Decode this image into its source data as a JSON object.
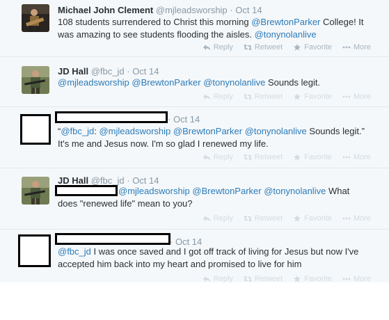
{
  "actions": {
    "reply": "Reply",
    "retweet": "Retweet",
    "favorite": "Favorite",
    "more": "More"
  },
  "tweets": [
    {
      "fullname": "Michael John Clement",
      "username": "@mjleadsworship",
      "time": "Oct 14",
      "line1_pre": "108 students surrendered to Christ this morning ",
      "line1_mention": "@BrewtonParker",
      "line1_post": " College! It",
      "line2_pre": "was amazing to see students flooding the aisles.  ",
      "line2_mention": "@tonynolanlive"
    },
    {
      "fullname": "JD Hall",
      "username": "@fbc_jd",
      "time": "Oct 14",
      "m1": "@mjleadsworship",
      "m2": "@BrewtonParker",
      "m3": "@tonynolanlive",
      "tail": " Sounds legit."
    },
    {
      "time": "Oct 14",
      "q_open": "“",
      "m0": "@fbc_jd",
      "colon": ": ",
      "m1": "@mjleadsworship",
      "m2": "@BrewtonParker",
      "m3": "@tonynolanlive",
      "tail": " Sounds legit.”",
      "line2": "It's me and Jesus now. I'm so glad I renewed my life."
    },
    {
      "fullname": "JD Hall",
      "username": "@fbc_jd",
      "time": "Oct 14",
      "m1": "@mjleadsworship",
      "m2": "@BrewtonParker",
      "m3": "@tonynolanlive",
      "tail": " What",
      "line2": "does \"renewed life\" mean to you?"
    },
    {
      "time": "Oct 14",
      "m0": "@fbc_jd",
      "line1_rest": " I was once saved and I got off track of living for Jesus but now I've",
      "line2": "accepted him back into my heart and promised to live for him"
    }
  ],
  "colors": {
    "mention": "#2b7bb9",
    "background": "#f5f8fa",
    "action_text": "#a8b6c2"
  },
  "icons": [
    "reply-icon",
    "retweet-icon",
    "favorite-icon",
    "more-icon"
  ]
}
